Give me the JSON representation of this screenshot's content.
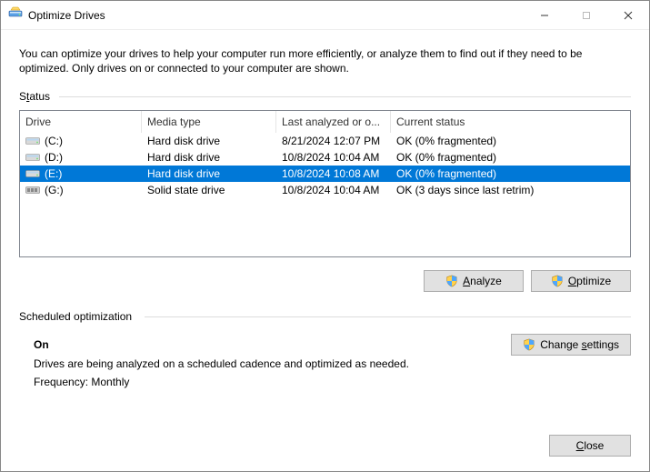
{
  "window": {
    "title": "Optimize Drives"
  },
  "intro": "You can optimize your drives to help your computer run more efficiently, or analyze them to find out if they need to be optimized. Only drives on or connected to your computer are shown.",
  "status": {
    "label": "Status",
    "columns": {
      "drive": "Drive",
      "media": "Media type",
      "last": "Last analyzed or o...",
      "status": "Current status"
    },
    "rows": [
      {
        "drive": "(C:)",
        "media": "Hard disk drive",
        "last": "8/21/2024 12:07 PM",
        "status": "OK (0% fragmented)",
        "iconType": "hdd",
        "selected": false
      },
      {
        "drive": "(D:)",
        "media": "Hard disk drive",
        "last": "10/8/2024 10:04 AM",
        "status": "OK (0% fragmented)",
        "iconType": "hdd",
        "selected": false
      },
      {
        "drive": "(E:)",
        "media": "Hard disk drive",
        "last": "10/8/2024 10:08 AM",
        "status": "OK (0% fragmented)",
        "iconType": "hdd",
        "selected": true
      },
      {
        "drive": "(G:)",
        "media": "Solid state drive",
        "last": "10/8/2024 10:04 AM",
        "status": "OK (3 days since last retrim)",
        "iconType": "ssd",
        "selected": false
      }
    ]
  },
  "buttons": {
    "analyze": "Analyze",
    "optimize": "Optimize",
    "change": "Change settings",
    "close": "Close"
  },
  "schedule": {
    "label": "Scheduled optimization",
    "on": "On",
    "desc": "Drives are being analyzed on a scheduled cadence and optimized as needed.",
    "freq": "Frequency: Monthly"
  }
}
